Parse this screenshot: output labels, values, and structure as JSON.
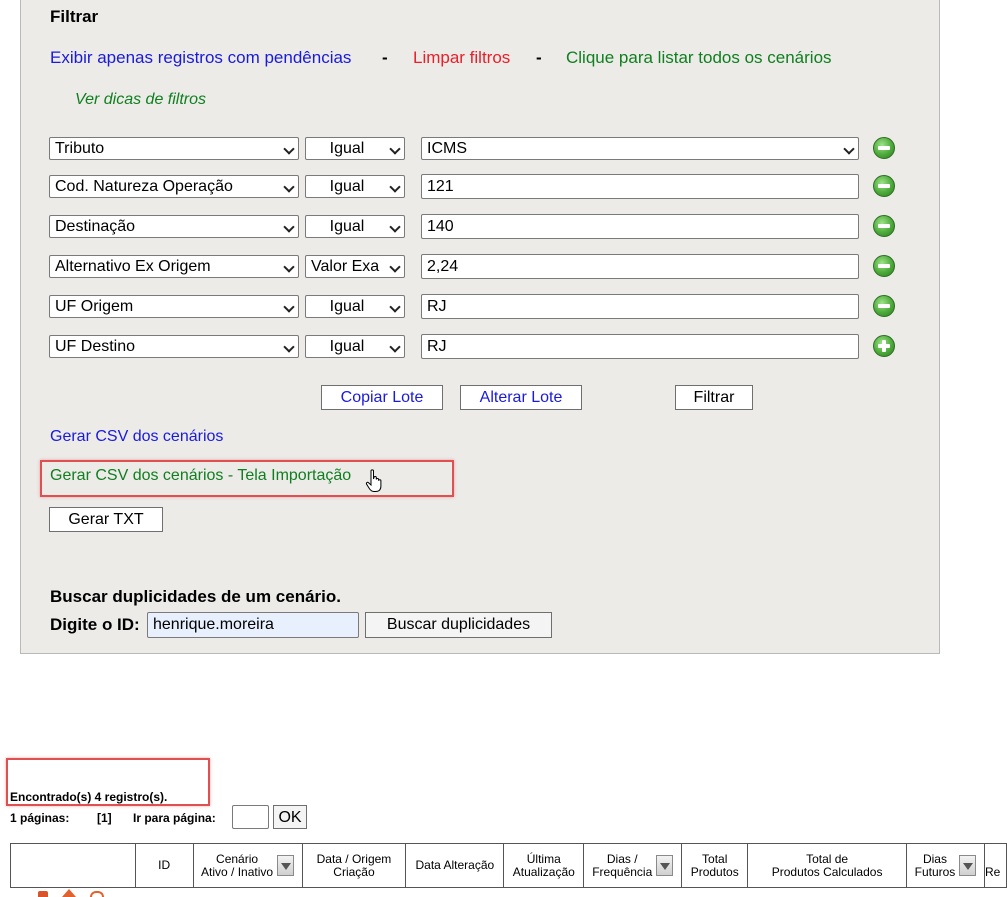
{
  "filter": {
    "title": "Filtrar",
    "links": {
      "only_pending": "Exibir apenas registros com pendências",
      "separator": "-",
      "clear": "Limpar filtros",
      "list_all": "Clique para listar todos os cenários",
      "tips": "Ver dicas de filtros"
    },
    "rows": [
      {
        "field": "Tributo",
        "operator": "Igual",
        "value": "ICMS",
        "value_is_select": true,
        "action": "remove"
      },
      {
        "field": "Cod. Natureza Operação",
        "operator": "Igual",
        "value": "121",
        "value_is_select": false,
        "action": "remove"
      },
      {
        "field": "Destinação",
        "operator": "Igual",
        "value": "140",
        "value_is_select": false,
        "action": "remove"
      },
      {
        "field": "Alternativo Ex Origem",
        "operator": "Valor Exa",
        "value": "2,24",
        "value_is_select": false,
        "action": "remove"
      },
      {
        "field": "UF Origem",
        "operator": "Igual",
        "value": "RJ",
        "value_is_select": false,
        "action": "remove"
      },
      {
        "field": "UF Destino",
        "operator": "Igual",
        "value": "RJ",
        "value_is_select": false,
        "action": "add"
      }
    ],
    "buttons": {
      "copy_batch": "Copiar Lote",
      "alter_batch": "Alterar Lote",
      "filter": "Filtrar"
    },
    "csv_link": "Gerar CSV dos cenários",
    "csv_import_link": "Gerar CSV dos cenários - Tela Importação",
    "txt_button": "Gerar TXT",
    "duplicates": {
      "title": "Buscar duplicidades de um cenário.",
      "id_label": "Digite o ID:",
      "id_value": "henrique.moreira",
      "search_button": "Buscar duplicidades"
    }
  },
  "results": {
    "found_text": "Encontrado(s) 4 registro(s).",
    "pages_label": "1 páginas:",
    "current_page": "[1]",
    "goto_label": "Ir para página:",
    "goto_value": "",
    "ok_button": "OK"
  },
  "table": {
    "headers": [
      {
        "line1": "",
        "line2": "",
        "sort": false
      },
      {
        "line1": "ID",
        "line2": "",
        "sort": false
      },
      {
        "line1": "Cenário",
        "line2": "Ativo / Inativo",
        "sort": true
      },
      {
        "line1": "Data / Origem",
        "line2": "Criação",
        "sort": false
      },
      {
        "line1": "Data Alteração",
        "line2": "",
        "sort": false
      },
      {
        "line1": "Última",
        "line2": "Atualização",
        "sort": false
      },
      {
        "line1": "Dias /",
        "line2": "Frequência",
        "sort": true
      },
      {
        "line1": "Total",
        "line2": "Produtos",
        "sort": false
      },
      {
        "line1": "Total de",
        "line2": "Produtos Calculados",
        "sort": false
      },
      {
        "line1": "Dias",
        "line2": "Futuros",
        "sort": true
      },
      {
        "line1": "",
        "line2": "Re",
        "sort": false
      }
    ]
  },
  "colors": {
    "link_blue": "#1a1adc",
    "link_red": "#e8202a",
    "link_green": "#0f7f1f",
    "panel_bg": "#ecebe8",
    "highlight_red": "#e05050"
  }
}
